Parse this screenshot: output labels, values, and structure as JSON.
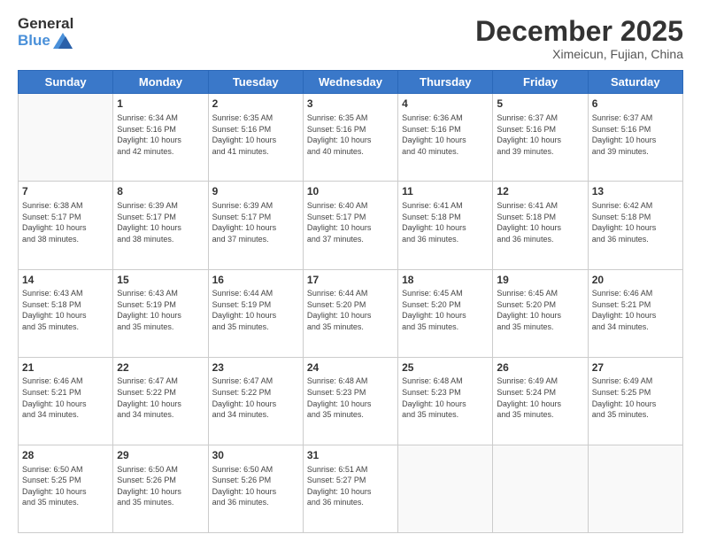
{
  "logo": {
    "general": "General",
    "blue": "Blue"
  },
  "header": {
    "month": "December 2025",
    "location": "Ximeicun, Fujian, China"
  },
  "weekdays": [
    "Sunday",
    "Monday",
    "Tuesday",
    "Wednesday",
    "Thursday",
    "Friday",
    "Saturday"
  ],
  "weeks": [
    [
      {
        "day": "",
        "info": ""
      },
      {
        "day": "1",
        "info": "Sunrise: 6:34 AM\nSunset: 5:16 PM\nDaylight: 10 hours\nand 42 minutes."
      },
      {
        "day": "2",
        "info": "Sunrise: 6:35 AM\nSunset: 5:16 PM\nDaylight: 10 hours\nand 41 minutes."
      },
      {
        "day": "3",
        "info": "Sunrise: 6:35 AM\nSunset: 5:16 PM\nDaylight: 10 hours\nand 40 minutes."
      },
      {
        "day": "4",
        "info": "Sunrise: 6:36 AM\nSunset: 5:16 PM\nDaylight: 10 hours\nand 40 minutes."
      },
      {
        "day": "5",
        "info": "Sunrise: 6:37 AM\nSunset: 5:16 PM\nDaylight: 10 hours\nand 39 minutes."
      },
      {
        "day": "6",
        "info": "Sunrise: 6:37 AM\nSunset: 5:16 PM\nDaylight: 10 hours\nand 39 minutes."
      }
    ],
    [
      {
        "day": "7",
        "info": "Sunrise: 6:38 AM\nSunset: 5:17 PM\nDaylight: 10 hours\nand 38 minutes."
      },
      {
        "day": "8",
        "info": "Sunrise: 6:39 AM\nSunset: 5:17 PM\nDaylight: 10 hours\nand 38 minutes."
      },
      {
        "day": "9",
        "info": "Sunrise: 6:39 AM\nSunset: 5:17 PM\nDaylight: 10 hours\nand 37 minutes."
      },
      {
        "day": "10",
        "info": "Sunrise: 6:40 AM\nSunset: 5:17 PM\nDaylight: 10 hours\nand 37 minutes."
      },
      {
        "day": "11",
        "info": "Sunrise: 6:41 AM\nSunset: 5:18 PM\nDaylight: 10 hours\nand 36 minutes."
      },
      {
        "day": "12",
        "info": "Sunrise: 6:41 AM\nSunset: 5:18 PM\nDaylight: 10 hours\nand 36 minutes."
      },
      {
        "day": "13",
        "info": "Sunrise: 6:42 AM\nSunset: 5:18 PM\nDaylight: 10 hours\nand 36 minutes."
      }
    ],
    [
      {
        "day": "14",
        "info": "Sunrise: 6:43 AM\nSunset: 5:18 PM\nDaylight: 10 hours\nand 35 minutes."
      },
      {
        "day": "15",
        "info": "Sunrise: 6:43 AM\nSunset: 5:19 PM\nDaylight: 10 hours\nand 35 minutes."
      },
      {
        "day": "16",
        "info": "Sunrise: 6:44 AM\nSunset: 5:19 PM\nDaylight: 10 hours\nand 35 minutes."
      },
      {
        "day": "17",
        "info": "Sunrise: 6:44 AM\nSunset: 5:20 PM\nDaylight: 10 hours\nand 35 minutes."
      },
      {
        "day": "18",
        "info": "Sunrise: 6:45 AM\nSunset: 5:20 PM\nDaylight: 10 hours\nand 35 minutes."
      },
      {
        "day": "19",
        "info": "Sunrise: 6:45 AM\nSunset: 5:20 PM\nDaylight: 10 hours\nand 35 minutes."
      },
      {
        "day": "20",
        "info": "Sunrise: 6:46 AM\nSunset: 5:21 PM\nDaylight: 10 hours\nand 34 minutes."
      }
    ],
    [
      {
        "day": "21",
        "info": "Sunrise: 6:46 AM\nSunset: 5:21 PM\nDaylight: 10 hours\nand 34 minutes."
      },
      {
        "day": "22",
        "info": "Sunrise: 6:47 AM\nSunset: 5:22 PM\nDaylight: 10 hours\nand 34 minutes."
      },
      {
        "day": "23",
        "info": "Sunrise: 6:47 AM\nSunset: 5:22 PM\nDaylight: 10 hours\nand 34 minutes."
      },
      {
        "day": "24",
        "info": "Sunrise: 6:48 AM\nSunset: 5:23 PM\nDaylight: 10 hours\nand 35 minutes."
      },
      {
        "day": "25",
        "info": "Sunrise: 6:48 AM\nSunset: 5:23 PM\nDaylight: 10 hours\nand 35 minutes."
      },
      {
        "day": "26",
        "info": "Sunrise: 6:49 AM\nSunset: 5:24 PM\nDaylight: 10 hours\nand 35 minutes."
      },
      {
        "day": "27",
        "info": "Sunrise: 6:49 AM\nSunset: 5:25 PM\nDaylight: 10 hours\nand 35 minutes."
      }
    ],
    [
      {
        "day": "28",
        "info": "Sunrise: 6:50 AM\nSunset: 5:25 PM\nDaylight: 10 hours\nand 35 minutes."
      },
      {
        "day": "29",
        "info": "Sunrise: 6:50 AM\nSunset: 5:26 PM\nDaylight: 10 hours\nand 35 minutes."
      },
      {
        "day": "30",
        "info": "Sunrise: 6:50 AM\nSunset: 5:26 PM\nDaylight: 10 hours\nand 36 minutes."
      },
      {
        "day": "31",
        "info": "Sunrise: 6:51 AM\nSunset: 5:27 PM\nDaylight: 10 hours\nand 36 minutes."
      },
      {
        "day": "",
        "info": ""
      },
      {
        "day": "",
        "info": ""
      },
      {
        "day": "",
        "info": ""
      }
    ]
  ]
}
